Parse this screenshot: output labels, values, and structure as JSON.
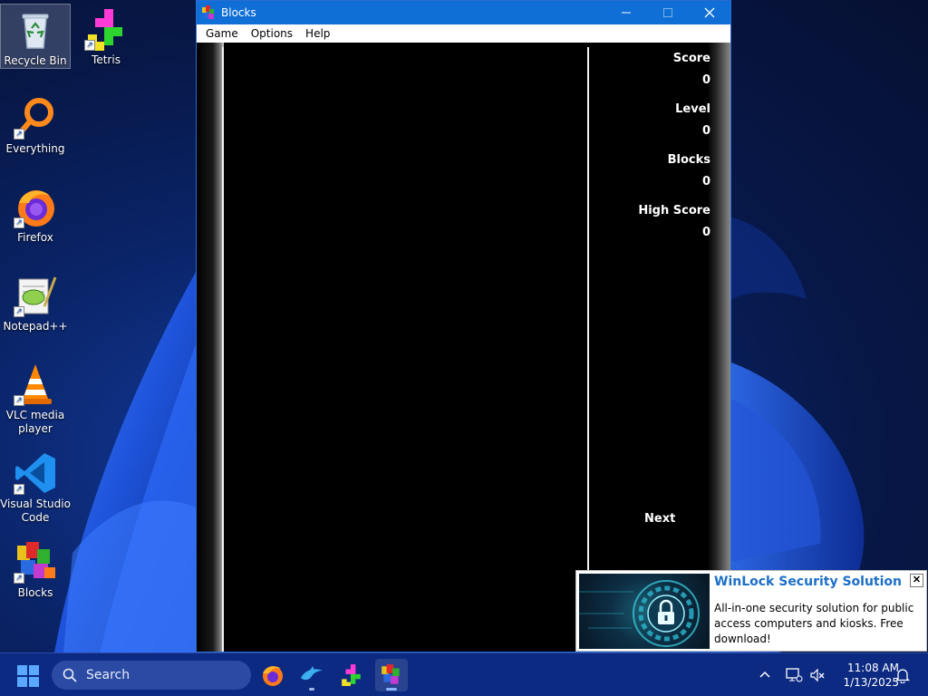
{
  "desktop": {
    "icons": [
      {
        "label": "Recycle Bin"
      },
      {
        "label": "Tetris"
      },
      {
        "label": "Everything"
      },
      {
        "label": "Firefox"
      },
      {
        "label": "Notepad++"
      },
      {
        "label": "VLC media player"
      },
      {
        "label": "Visual Studio Code"
      },
      {
        "label": "Blocks"
      }
    ]
  },
  "window": {
    "title": "Blocks",
    "menu": [
      "Game",
      "Options",
      "Help"
    ],
    "stats": [
      {
        "label": "Score",
        "value": "0"
      },
      {
        "label": "Level",
        "value": "0"
      },
      {
        "label": "Blocks",
        "value": "0"
      },
      {
        "label": "High Score",
        "value": "0"
      }
    ],
    "next_label": "Next"
  },
  "notification": {
    "title": "WinLock Security Solution",
    "body": "All-in-one security solution for public access computers and kiosks. Free download!",
    "close_glyph": "✕"
  },
  "taskbar": {
    "search_placeholder": "Search",
    "time": "11:08 AM",
    "date": "1/13/2025",
    "apps": [
      "firefox",
      "dolphin",
      "tetris",
      "blocks"
    ]
  },
  "colors": {
    "titlebar": "#0f6fd6",
    "taskbar": "#0c2a82",
    "notification_title": "#1c6fc7"
  }
}
